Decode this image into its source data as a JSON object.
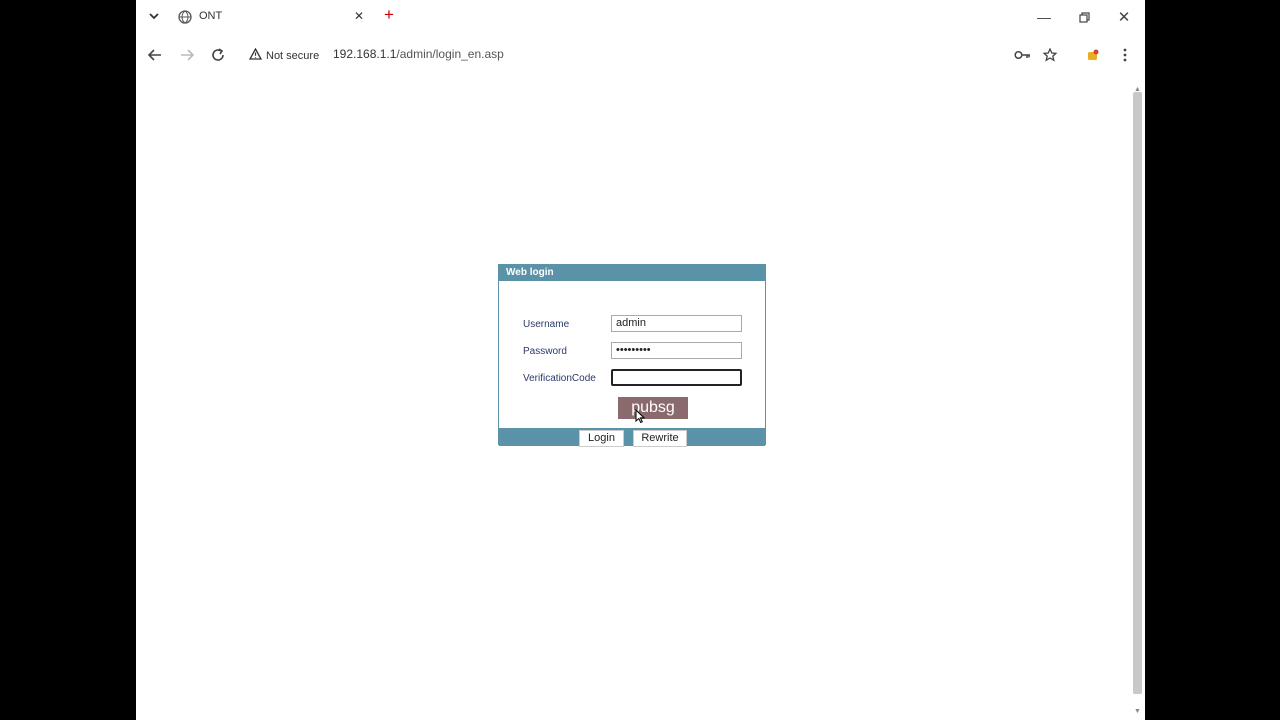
{
  "tab": {
    "title": "ONT"
  },
  "toolbar": {
    "security_label": "Not secure",
    "url_host": "192.168.1.1",
    "url_path": "/admin/login_en.asp"
  },
  "login": {
    "header": "Web login",
    "username_label": "Username",
    "username_value": "admin",
    "password_label": "Password",
    "password_value": "•••••••••",
    "verification_label": "VerificationCode",
    "verification_value": "",
    "captcha_text": "pubsg",
    "login_button": "Login",
    "rewrite_button": "Rewrite"
  },
  "colors": {
    "panel_accent": "#5a92a8",
    "captcha_bg": "#8b6a6e",
    "new_tab_plus": "#cc0000"
  },
  "icons": {
    "tab_menu": "chevron-down-icon",
    "favicon": "globe-icon",
    "tab_close": "close-icon",
    "new_tab": "plus-icon",
    "back": "arrow-left-icon",
    "forward": "arrow-right-icon",
    "reload": "reload-icon",
    "security": "warning-icon",
    "passwords": "key-icon",
    "bookmark": "star-icon",
    "extension": "extension-icon",
    "menu": "kebab-menu-icon"
  }
}
